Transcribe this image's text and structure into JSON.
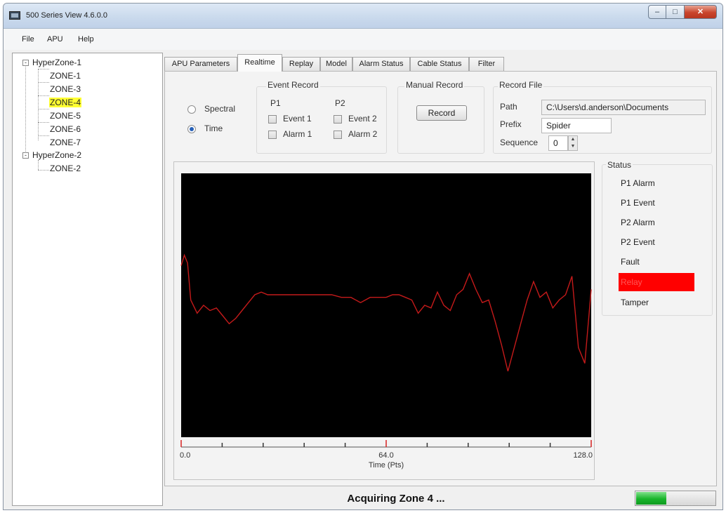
{
  "window": {
    "title": "500 Series View 4.6.0.0"
  },
  "menu": [
    "File",
    "APU",
    "Help"
  ],
  "tree": {
    "groups": [
      {
        "label": "HyperZone-1",
        "children": [
          "ZONE-1",
          "ZONE-3",
          "ZONE-4",
          "ZONE-5",
          "ZONE-6",
          "ZONE-7"
        ]
      },
      {
        "label": "HyperZone-2",
        "children": [
          "ZONE-2"
        ]
      }
    ],
    "selected": "ZONE-4",
    "expander_glyph": "-",
    "highlight_color": "#ffff33"
  },
  "tabs": [
    "APU Parameters",
    "Realtime",
    "Replay",
    "Model",
    "Alarm Status",
    "Cable Status",
    "Filter"
  ],
  "active_tab": "Realtime",
  "mode": {
    "spectral_label": "Spectral",
    "time_label": "Time",
    "selected": "Time"
  },
  "event_record": {
    "title": "Event Record",
    "p1_label": "P1",
    "p2_label": "P2",
    "event1_label": "Event 1",
    "alarm1_label": "Alarm 1",
    "event2_label": "Event 2",
    "alarm2_label": "Alarm 2"
  },
  "manual_record": {
    "title": "Manual Record",
    "button_label": "Record"
  },
  "record_file": {
    "title": "Record File",
    "path_label": "Path",
    "path_value": "C:\\Users\\d.anderson\\Documents",
    "prefix_label": "Prefix",
    "prefix_value": "Spider",
    "sequence_label": "Sequence",
    "sequence_value": "0"
  },
  "status_panel": {
    "title": "Status",
    "items": [
      "P1 Alarm",
      "P1 Event",
      "P2 Alarm",
      "P2 Event",
      "Fault",
      "Relay",
      "Tamper"
    ],
    "active": "Relay",
    "active_color": "#ff0000"
  },
  "statusbar": {
    "message": "Acquiring Zone 4 ...",
    "progress": 0.38,
    "progress_color": "#19b52b"
  },
  "chart_data": {
    "type": "line",
    "xlabel": "Time (Pts)",
    "x_ticks": [
      "0.0",
      "64.0",
      "128.0"
    ],
    "xlim": [
      0,
      128
    ],
    "ylim": [
      0,
      100
    ],
    "background": "#000000",
    "line_color": "#c41a1a",
    "tick_color": "#d62020",
    "grid": false,
    "x": [
      0,
      1,
      2,
      3,
      5,
      7,
      9,
      11,
      13,
      15,
      17,
      19,
      21,
      23,
      25,
      27,
      29,
      31,
      33,
      35,
      38,
      41,
      44,
      47,
      50,
      53,
      56,
      59,
      62,
      64,
      66,
      68,
      70,
      72,
      74,
      76,
      78,
      80,
      82,
      84,
      86,
      88,
      90,
      92,
      94,
      96,
      98,
      100,
      102,
      104,
      106,
      108,
      110,
      112,
      114,
      116,
      118,
      120,
      122,
      124,
      126,
      128
    ],
    "y": [
      65,
      69,
      66,
      52,
      47,
      50,
      48,
      49,
      46,
      43,
      45,
      48,
      51,
      54,
      55,
      54,
      54,
      54,
      54,
      54,
      54,
      54,
      54,
      54,
      53,
      53,
      51,
      53,
      53,
      53,
      54,
      54,
      53,
      52,
      47,
      50,
      49,
      55,
      50,
      48,
      54,
      56,
      62,
      56,
      51,
      52,
      44,
      35,
      25,
      34,
      43,
      52,
      59,
      53,
      55,
      49,
      52,
      54,
      61,
      34,
      28,
      56
    ]
  }
}
